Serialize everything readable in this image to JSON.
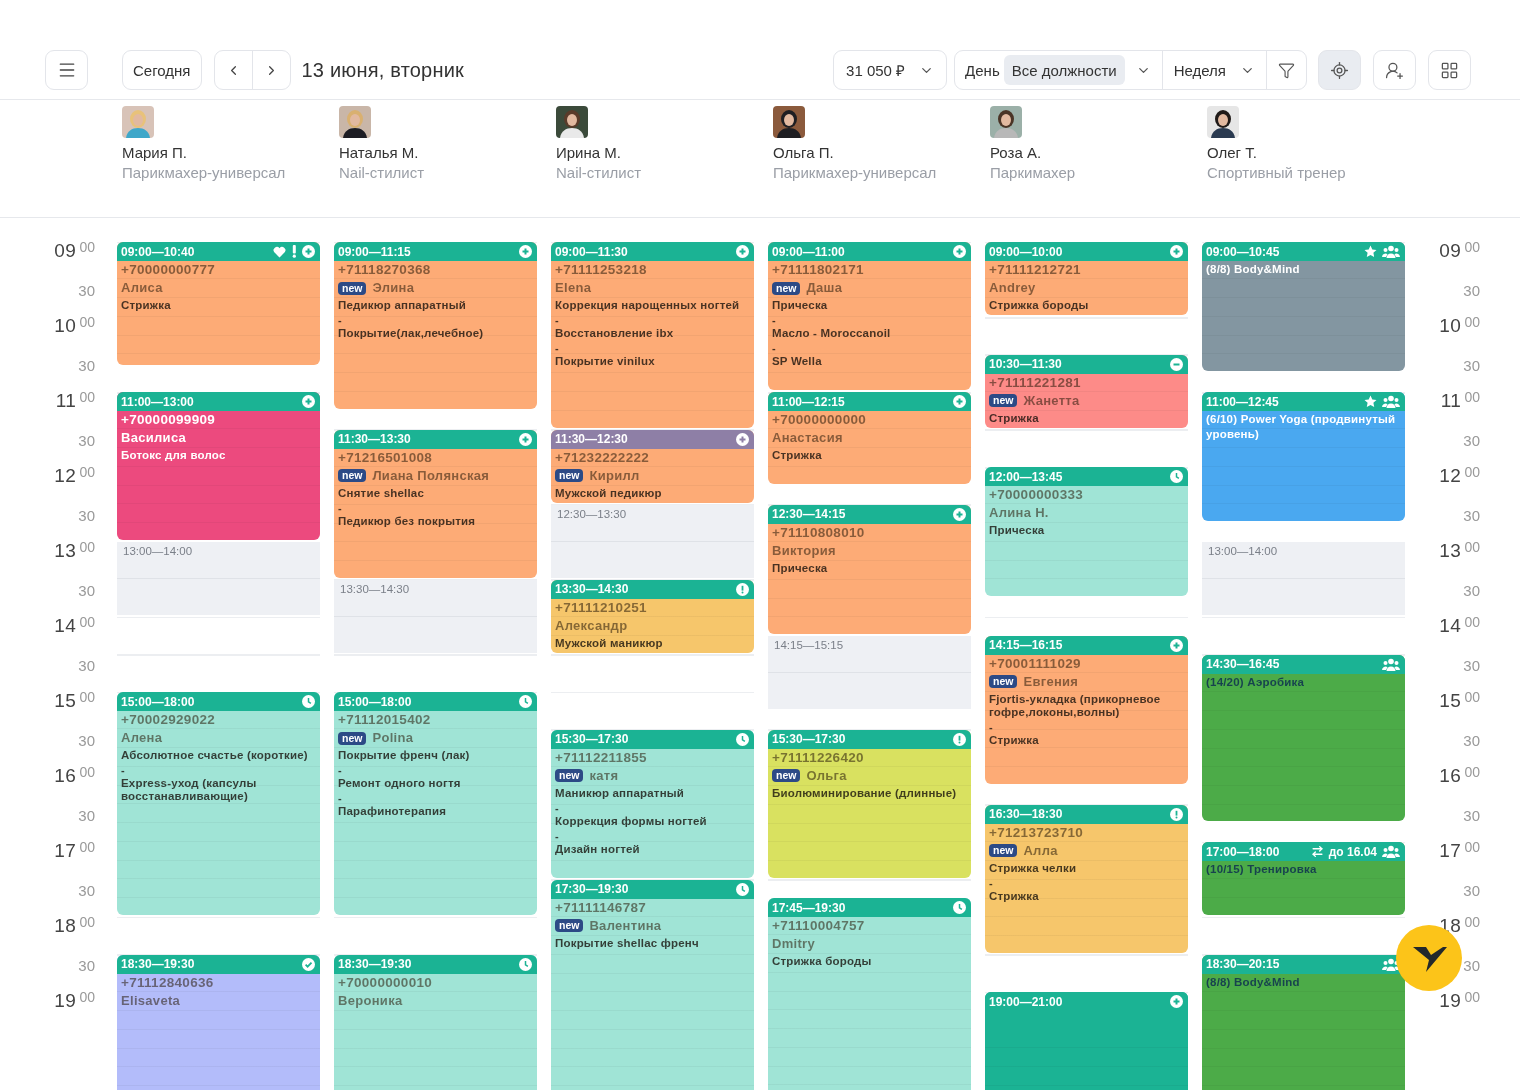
{
  "toolbar": {
    "today": "Сегодня",
    "date": "13 июня, вторник",
    "revenue": "31 050 ₽",
    "view": {
      "day": "День",
      "position": "Все должности",
      "period": "Неделя"
    },
    "icon_buttons": [
      {
        "kind": "locate",
        "selected": true
      },
      {
        "kind": "add-user",
        "selected": false
      },
      {
        "kind": "grid",
        "selected": false
      }
    ]
  },
  "staff": [
    {
      "name": "Мария П.",
      "role": "Парикмахер-универсал"
    },
    {
      "name": "Наталья М.",
      "role": "Nail-стилист"
    },
    {
      "name": "Ирина М.",
      "role": "Nail-стилист"
    },
    {
      "name": "Ольга П.",
      "role": "Парикмахер-универсал"
    },
    {
      "name": "Роза А.",
      "role": "Паркимахер"
    },
    {
      "name": "Олег Т.",
      "role": "Спортивный тренер"
    }
  ],
  "time_labels_left": [
    {
      "hour": "09",
      "minutes": "00"
    },
    {
      "minutes": "30"
    },
    {
      "hour": "10",
      "minutes": "00"
    },
    {
      "minutes": "30"
    },
    {
      "hour": "11",
      "minutes": "00"
    },
    {
      "minutes": "30"
    },
    {
      "hour": "12",
      "minutes": "00"
    },
    {
      "minutes": "30"
    },
    {
      "hour": "13",
      "minutes": "00"
    },
    {
      "minutes": "30"
    },
    {
      "hour": "14",
      "minutes": "00"
    },
    {
      "minutes": "30"
    },
    {
      "hour": "15",
      "minutes": "00"
    },
    {
      "minutes": "30"
    },
    {
      "hour": "16",
      "minutes": "00"
    },
    {
      "minutes": "30"
    },
    {
      "hour": "17",
      "minutes": "00"
    },
    {
      "minutes": "30"
    },
    {
      "hour": "18",
      "minutes": "00"
    },
    {
      "minutes": "30"
    },
    {
      "hour": "19",
      "minutes": "00"
    }
  ],
  "time_labels_right": [
    {
      "hour": "09",
      "minutes": "00"
    },
    {
      "minutes": "30"
    },
    {
      "hour": "10",
      "minutes": "00"
    },
    {
      "minutes": "30"
    },
    {
      "hour": "11",
      "minutes": "00"
    },
    {
      "minutes": "30"
    },
    {
      "hour": "12",
      "minutes": "00"
    },
    {
      "minutes": "30"
    },
    {
      "hour": "13",
      "minutes": "00"
    },
    {
      "minutes": "30"
    },
    {
      "hour": "14",
      "minutes": "00"
    },
    {
      "minutes": "30"
    },
    {
      "hour": "15",
      "minutes": "00"
    },
    {
      "minutes": "30"
    },
    {
      "hour": "16",
      "minutes": "00"
    },
    {
      "minutes": "30"
    },
    {
      "hour": "17",
      "minutes": "00"
    },
    {
      "minutes": "30"
    },
    {
      "hour": "18",
      "minutes": "00"
    },
    {
      "minutes": "30"
    },
    {
      "hour": "19",
      "minutes": "00"
    }
  ],
  "columns": [
    {
      "events": [
        {
          "kind": "appointment",
          "time": "09:00—10:40",
          "icons": [
            {
              "kind": "heart"
            },
            {
              "kind": "flag"
            },
            {
              "kind": "plus"
            }
          ],
          "color": "#fdab76",
          "phone": "+70000000777",
          "client": "Алиса",
          "services": [
            "Стрижка"
          ]
        },
        {
          "kind": "appointment",
          "time": "11:00—13:00",
          "icons": [
            {
              "kind": "plus"
            }
          ],
          "color": "#ec4a7e",
          "light_text": true,
          "phone": "+70000099909",
          "client": "Василиса",
          "services": [
            "Ботокс для волос"
          ]
        },
        {
          "kind": "free",
          "time": "13:00—14:00"
        },
        {
          "kind": "appointment",
          "time": "15:00—18:00",
          "icons": [
            {
              "kind": "clock"
            }
          ],
          "color": "#a0e4d6",
          "phone": "+70002929022",
          "client": "Алена",
          "services": [
            "Абсолютное счастье (короткие)",
            "-",
            "Express-уход (капсулы восстанавливающие)"
          ]
        },
        {
          "kind": "appointment",
          "time": "18:30—19:30",
          "icons": [
            {
              "kind": "check"
            }
          ],
          "color": "#b3bcfa",
          "phone": "+71112840636",
          "client": "Elisaveta"
        }
      ]
    },
    {
      "events": [
        {
          "kind": "appointment",
          "time": "09:00—11:15",
          "icons": [
            {
              "kind": "plus"
            }
          ],
          "color": "#fdab76",
          "phone": "+71118270368",
          "badge": "new",
          "client": "Элина",
          "services": [
            "Педикюр аппаратный",
            "-",
            "Покрытие(лак,лечебное)"
          ]
        },
        {
          "kind": "appointment",
          "time": "11:30—13:30",
          "icons": [
            {
              "kind": "plus"
            }
          ],
          "color": "#fdab76",
          "phone": "+71216501008",
          "badge": "new",
          "client": "Лиана Полянская",
          "services": [
            "Снятие shellac",
            "-",
            "Педикюр без покрытия"
          ]
        },
        {
          "kind": "free",
          "time": "13:30—14:30"
        },
        {
          "kind": "appointment",
          "time": "15:00—18:00",
          "icons": [
            {
              "kind": "clock"
            }
          ],
          "color": "#a0e4d6",
          "phone": "+71112015402",
          "badge": "new",
          "client": "Polina",
          "services": [
            "Покрытие френч (лак)",
            "-",
            "Ремонт одного ногтя",
            "-",
            "Парафинотерапия"
          ]
        },
        {
          "kind": "appointment",
          "time": "18:30—19:30",
          "icons": [
            {
              "kind": "clock"
            }
          ],
          "color": "#a0e4d6",
          "phone": "+70000000010",
          "client": "Вероника"
        }
      ]
    },
    {
      "events": [
        {
          "kind": "appointment",
          "time": "09:00—11:30",
          "icons": [
            {
              "kind": "plus"
            }
          ],
          "color": "#fdab76",
          "phone": "+71111253218",
          "client": "Elena",
          "services": [
            "Коррекция нарощенных ногтей",
            "-",
            "Восстановление ibx",
            "-",
            "Покрытие vinilux"
          ]
        },
        {
          "kind": "appointment",
          "time": "11:30—12:30",
          "icons": [
            {
              "kind": "plus"
            }
          ],
          "header": {
            "color": "#8e7fa6"
          },
          "color": "#fdab76",
          "phone": "+71232222222",
          "badge": "new",
          "client": "Кирилл",
          "services": [
            "Мужской педикюр"
          ]
        },
        {
          "kind": "free",
          "time": "12:30—13:30"
        },
        {
          "kind": "appointment",
          "time": "13:30—14:30",
          "icons": [
            {
              "kind": "alert"
            }
          ],
          "color": "#f6c66b",
          "phone": "+71111210251",
          "client": "Александр",
          "services": [
            "Мужской маникюр"
          ]
        },
        {
          "kind": "appointment",
          "time": "15:30—17:30",
          "icons": [
            {
              "kind": "clock"
            }
          ],
          "color": "#a0e4d6",
          "phone": "+71112211855",
          "badge": "new",
          "client": "катя",
          "services": [
            "Маникюр аппаратный",
            "-",
            "Коррекция формы ногтей",
            "-",
            "Дизайн ногтей"
          ]
        },
        {
          "kind": "appointment",
          "time": "17:30—19:30",
          "icons": [
            {
              "kind": "clock"
            }
          ],
          "color": "#a0e4d6",
          "phone": "+71111146787",
          "badge": "new",
          "client": "Валентина",
          "services": [
            "Покрытие shellac френч"
          ]
        }
      ]
    },
    {
      "events": [
        {
          "kind": "appointment",
          "time": "09:00—11:00",
          "icons": [
            {
              "kind": "plus"
            }
          ],
          "color": "#fdab76",
          "phone": "+71111802171",
          "badge": "new",
          "client": "Даша",
          "services": [
            "Прическа",
            "-",
            "Масло - Moroccanoil",
            "-",
            "SP Wella"
          ]
        },
        {
          "kind": "appointment",
          "time": "11:00—12:15",
          "icons": [
            {
              "kind": "plus"
            }
          ],
          "color": "#fdab76",
          "phone": "+70000000000",
          "client": "Анастасия",
          "services": [
            "Стрижка"
          ]
        },
        {
          "kind": "appointment",
          "time": "12:30—14:15",
          "icons": [
            {
              "kind": "plus"
            }
          ],
          "color": "#fdab76",
          "phone": "+71110808010",
          "client": "Виктория",
          "services": [
            "Прическа"
          ]
        },
        {
          "kind": "free",
          "time": "14:15—15:15"
        },
        {
          "kind": "appointment",
          "time": "15:30—17:30",
          "icons": [
            {
              "kind": "alert"
            }
          ],
          "color": "#d9e160",
          "phone": "+71111226420",
          "badge": "new",
          "client": "Ольга",
          "services": [
            "Биолюминирование (длинные)"
          ]
        },
        {
          "kind": "appointment",
          "time": "17:45—19:30",
          "icons": [
            {
              "kind": "clock"
            }
          ],
          "color": "#a0e4d6",
          "phone": "+71110004757",
          "client": "Dmitry",
          "services": [
            "Стрижка бороды"
          ]
        }
      ]
    },
    {
      "events": [
        {
          "kind": "appointment",
          "time": "09:00—10:00",
          "icons": [
            {
              "kind": "plus"
            }
          ],
          "color": "#fdab76",
          "phone": "+71111212721",
          "client": "Andrey",
          "services": [
            "Стрижка бороды"
          ]
        },
        {
          "kind": "appointment",
          "time": "10:30—11:30",
          "icons": [
            {
              "kind": "minus"
            }
          ],
          "color": "#fd8b88",
          "phone": "+71111221281",
          "badge": "new",
          "client": "Жанетта",
          "services": [
            "Стрижка"
          ]
        },
        {
          "kind": "appointment",
          "time": "12:00—13:45",
          "icons": [
            {
              "kind": "clock"
            }
          ],
          "color": "#a0e4d6",
          "phone": "+70000000333",
          "client": "Алина Н.",
          "services": [
            "Прическа"
          ]
        },
        {
          "kind": "appointment",
          "time": "14:15—16:15",
          "icons": [
            {
              "kind": "plus"
            }
          ],
          "color": "#fdab76",
          "phone": "+70001111029",
          "badge": "new",
          "client": "Евгения",
          "services": [
            "Fjortis-укладка (прикорневое гофре,локоны,волны)",
            "-",
            "Стрижка"
          ]
        },
        {
          "kind": "appointment",
          "time": "16:30—18:30",
          "icons": [
            {
              "kind": "alert"
            }
          ],
          "color": "#f6c66b",
          "phone": "+71213723710",
          "badge": "new",
          "client": "Алла",
          "services": [
            "Стрижка челки",
            "-",
            "Стрижка"
          ]
        },
        {
          "kind": "appointment",
          "time": "19:00—21:00",
          "icons": [
            {
              "kind": "plus"
            }
          ],
          "color": "#1bb394"
        }
      ]
    },
    {
      "events": [
        {
          "kind": "class",
          "time": "09:00—10:45",
          "icons": [
            {
              "kind": "star"
            },
            {
              "kind": "group"
            }
          ],
          "color": "#8396a1",
          "light_text": true,
          "title": "(8/8) Body&Mind"
        },
        {
          "kind": "class",
          "time": "11:00—12:45",
          "icons": [
            {
              "kind": "star"
            },
            {
              "kind": "group"
            }
          ],
          "color": "#4aa8f0",
          "light_text": true,
          "title": "(6/10) Power Yoga (продвинутый уровень)"
        },
        {
          "kind": "free",
          "time": "13:00—14:00"
        },
        {
          "kind": "class",
          "time": "14:30—16:45",
          "icons": [
            {
              "kind": "group"
            }
          ],
          "color": "#4cab48",
          "title": "(14/20) Аэробика"
        },
        {
          "kind": "class",
          "time": "17:00—18:00",
          "icons": [
            {
              "kind": "group"
            }
          ],
          "repeat": "до 16.04",
          "color": "#4cab48",
          "title": "(10/15) Тренировка"
        },
        {
          "kind": "class",
          "time": "18:30—20:15",
          "icons": [
            {
              "kind": "group"
            }
          ],
          "color": "#4cab48",
          "title": "(8/8) Body&Mind"
        }
      ]
    }
  ]
}
